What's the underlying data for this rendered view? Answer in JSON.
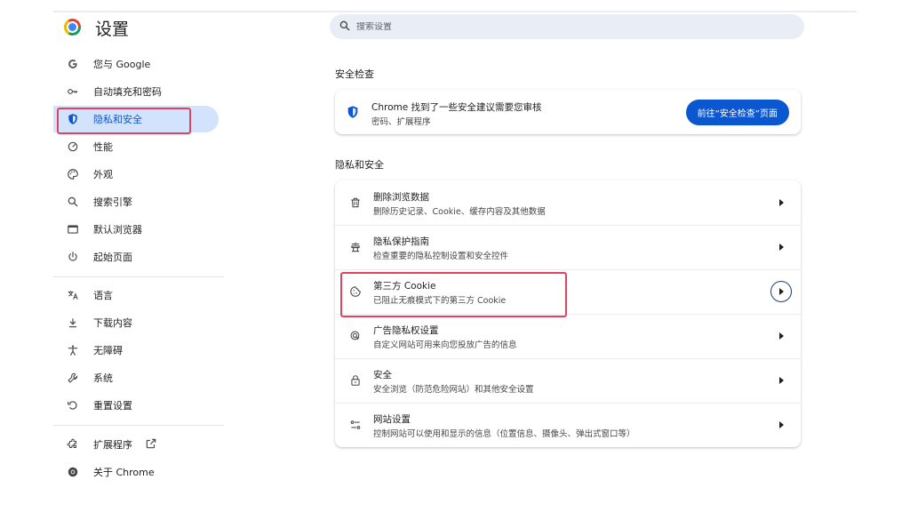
{
  "header": {
    "title": "设置",
    "search_placeholder": "搜索设置"
  },
  "sidebar": {
    "items": [
      {
        "label": "您与 Google",
        "icon": "google-g-icon"
      },
      {
        "label": "自动填充和密码",
        "icon": "key-icon"
      },
      {
        "label": "隐私和安全",
        "icon": "shield-icon",
        "active": true
      },
      {
        "label": "性能",
        "icon": "speedometer-icon"
      },
      {
        "label": "外观",
        "icon": "palette-icon"
      },
      {
        "label": "搜索引擎",
        "icon": "search-icon"
      },
      {
        "label": "默认浏览器",
        "icon": "browser-window-icon"
      },
      {
        "label": "起始页面",
        "icon": "power-icon"
      },
      {
        "label": "语言",
        "icon": "translate-icon"
      },
      {
        "label": "下载内容",
        "icon": "download-icon"
      },
      {
        "label": "无障碍",
        "icon": "accessibility-icon"
      },
      {
        "label": "系统",
        "icon": "wrench-icon"
      },
      {
        "label": "重置设置",
        "icon": "reset-icon"
      },
      {
        "label": "扩展程序",
        "icon": "puzzle-icon"
      },
      {
        "label": "关于 Chrome",
        "icon": "chrome-icon"
      }
    ]
  },
  "safety_check": {
    "section_title": "安全检查",
    "title": "Chrome 找到了一些安全建议需要您审核",
    "subtitle": "密码、扩展程序",
    "button_label": "前往“安全检查”页面"
  },
  "privacy": {
    "section_title": "隐私和安全",
    "rows": [
      {
        "title": "删除浏览数据",
        "subtitle": "删除历史记录、Cookie、缓存内容及其他数据",
        "icon": "trash-icon"
      },
      {
        "title": "隐私保护指南",
        "subtitle": "检查重要的隐私控制设置和安全控件",
        "icon": "privacy-guide-icon"
      },
      {
        "title": "第三方 Cookie",
        "subtitle": "已阻止无痕模式下的第三方 Cookie",
        "icon": "cookie-icon"
      },
      {
        "title": "广告隐私权设置",
        "subtitle": "自定义网站可用来向您投放广告的信息",
        "icon": "ad-privacy-icon"
      },
      {
        "title": "安全",
        "subtitle": "安全浏览（防范危险网站）和其他安全设置",
        "icon": "lock-icon"
      },
      {
        "title": "网站设置",
        "subtitle": "控制网站可以使用和显示的信息（位置信息、摄像头、弹出式窗口等）",
        "icon": "site-settings-icon"
      }
    ]
  },
  "colors": {
    "accent": "#0b57d0",
    "active_nav_bg": "#d3e3fd",
    "highlight_box": "#e0445c"
  }
}
